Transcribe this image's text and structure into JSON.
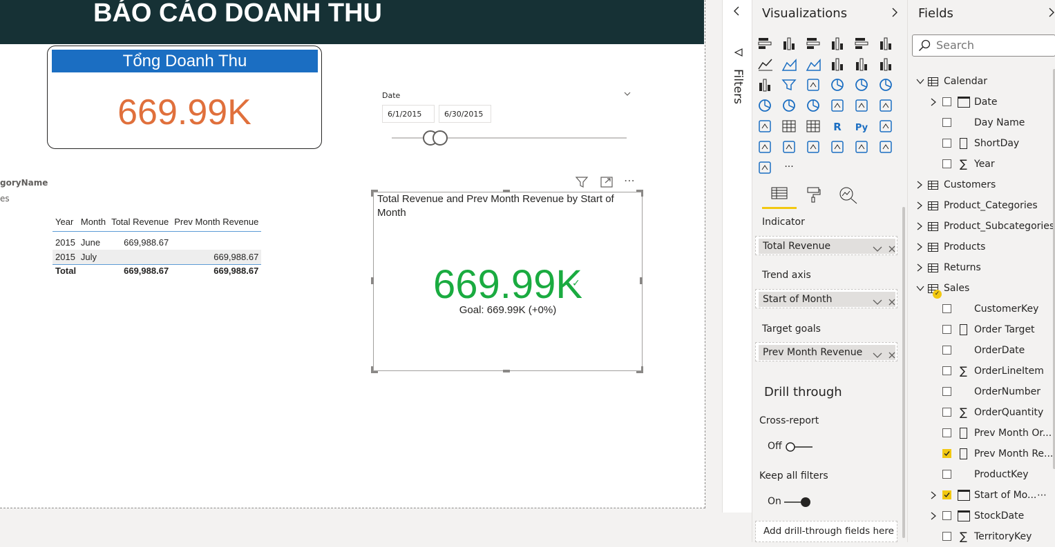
{
  "report": {
    "title": "BÁO CÁO DOANH THU",
    "card": {
      "title": "Tổng Doanh Thu",
      "value": "669.99K"
    },
    "slicer": {
      "label": "Date",
      "start": "6/1/2015",
      "end": "6/30/2015"
    },
    "partial": {
      "label": "goryName",
      "sub": "es"
    },
    "matrix": {
      "headers": [
        "Year",
        "Month",
        "Total Revenue",
        "Prev Month Revenue"
      ],
      "rows": [
        [
          "2015",
          "June",
          "669,988.67",
          ""
        ],
        [
          "2015",
          "July",
          "",
          "669,988.67"
        ]
      ],
      "total": [
        "Total",
        "669,988.67",
        "669,988.67"
      ]
    },
    "kpi": {
      "title": "Total Revenue and Prev Month Revenue by Start of Month",
      "value": "669.99K",
      "goal": "Goal: 669.99K (+0%)"
    },
    "colors": {
      "header": "#163135",
      "card_title": "#1b6ec2",
      "card_value": "#e0703c",
      "kpi_value": "#1aab40"
    }
  },
  "filters": {
    "label": "Filters"
  },
  "visualizations": {
    "title": "Visualizations",
    "icons": [
      "stacked-bar-icon",
      "stacked-column-icon",
      "clustered-bar-icon",
      "clustered-column-icon",
      "100-bar-icon",
      "100-column-icon",
      "line-chart-icon",
      "area-chart-icon",
      "stacked-area-icon",
      "line-column-icon",
      "line-clustered-column-icon",
      "ribbon-chart-icon",
      "waterfall-icon",
      "funnel-icon",
      "scatter-icon",
      "pie-chart-icon",
      "donut-chart-icon",
      "treemap-icon",
      "map-icon",
      "filled-map-icon",
      "gauge-icon",
      "card-icon",
      "multirow-card-icon",
      "kpi-icon",
      "slicer-icon",
      "table-icon",
      "matrix-icon",
      "r-visual-icon",
      "python-visual-icon",
      "key-influencers-icon",
      "decomposition-tree-icon",
      "qa-icon",
      "smart-narrative-icon",
      "paginated-report-icon",
      "power-apps-icon",
      "power-automate-icon",
      "arrow-visual-icon",
      "more-icon"
    ],
    "tabs": [
      "fields-tab",
      "format-tab",
      "analytics-tab"
    ],
    "wells": [
      {
        "label": "Indicator",
        "value": "Total Revenue"
      },
      {
        "label": "Trend axis",
        "value": "Start of Month"
      },
      {
        "label": "Target goals",
        "value": "Prev Month Revenue"
      }
    ],
    "drill": {
      "title": "Drill through",
      "cross_report": "Cross-report",
      "cross_state": "Off",
      "keep_filters": "Keep all filters",
      "keep_state": "On",
      "add_fields": "Add drill-through fields here"
    }
  },
  "fields": {
    "title": "Fields",
    "search_placeholder": "Search",
    "items": [
      {
        "label": "Calendar",
        "type": "table",
        "expanded": true,
        "indent": 0
      },
      {
        "label": "Date",
        "type": "calendar",
        "expand": true,
        "indent": 1,
        "checked": false
      },
      {
        "label": "Day Name",
        "type": "text",
        "indent": 1,
        "checked": false
      },
      {
        "label": "ShortDay",
        "type": "calc",
        "indent": 1,
        "checked": false
      },
      {
        "label": "Year",
        "type": "sigma",
        "indent": 1,
        "checked": false
      },
      {
        "label": "Customers",
        "type": "table",
        "expanded": false,
        "indent": 0
      },
      {
        "label": "Product_Categories",
        "type": "table",
        "expanded": false,
        "indent": 0
      },
      {
        "label": "Product_Subcategories",
        "type": "table",
        "expanded": false,
        "indent": 0
      },
      {
        "label": "Products",
        "type": "table",
        "expanded": false,
        "indent": 0
      },
      {
        "label": "Returns",
        "type": "table",
        "expanded": false,
        "indent": 0
      },
      {
        "label": "Sales",
        "type": "table",
        "expanded": true,
        "indent": 0
      },
      {
        "label": "CustomerKey",
        "type": "text",
        "indent": 1,
        "checked": false
      },
      {
        "label": "Order Target",
        "type": "calc",
        "indent": 1,
        "checked": false
      },
      {
        "label": "OrderDate",
        "type": "text",
        "indent": 1,
        "checked": false
      },
      {
        "label": "OrderLineItem",
        "type": "sigma",
        "indent": 1,
        "checked": false
      },
      {
        "label": "OrderNumber",
        "type": "text",
        "indent": 1,
        "checked": false
      },
      {
        "label": "OrderQuantity",
        "type": "sigma",
        "indent": 1,
        "checked": false
      },
      {
        "label": "Prev Month Or...",
        "type": "calc",
        "indent": 1,
        "checked": false
      },
      {
        "label": "Prev Month Re...",
        "type": "calc",
        "indent": 1,
        "checked": true
      },
      {
        "label": "ProductKey",
        "type": "text",
        "indent": 1,
        "checked": false
      },
      {
        "label": "Start of Mo...",
        "type": "calendar",
        "expand": true,
        "indent": 1,
        "checked": true
      },
      {
        "label": "StockDate",
        "type": "calendar",
        "expand": true,
        "indent": 1,
        "checked": false
      },
      {
        "label": "TerritoryKey",
        "type": "sigma",
        "indent": 1,
        "checked": false
      }
    ]
  }
}
